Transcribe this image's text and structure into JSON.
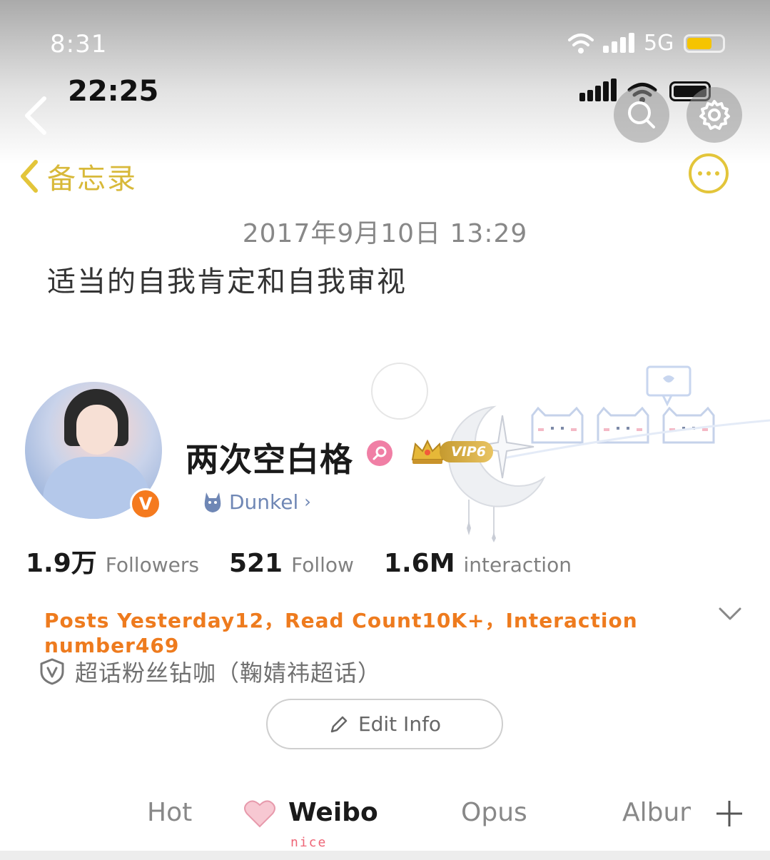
{
  "outer_status": {
    "time": "8:31",
    "network": "5G",
    "battery_color": "#f5c400"
  },
  "inner_status": {
    "time": "22:25"
  },
  "memo": {
    "back_label": "备忘录",
    "date": "2017年9月10日 13:29",
    "body": "适当的自我肯定和自我审视"
  },
  "profile": {
    "name": "两次空白格",
    "verified_badge": "V",
    "vip_label": "VIP6",
    "pet_label": "Dunkel",
    "pet_chevron": "›",
    "stats": [
      {
        "value": "1.9万",
        "label": "Followers"
      },
      {
        "value": "521",
        "label": "Follow"
      },
      {
        "value": "1.6M",
        "label": "interaction"
      }
    ],
    "summary": "Posts Yesterday12，Read Count10K+，Interaction number469",
    "fan_label": "超话粉丝钻咖（鞠婧祎超话）",
    "edit_label": "Edit Info"
  },
  "tabs": {
    "items": [
      "Hot",
      "Weibo",
      "Opus",
      "Album"
    ],
    "active": "Weibo",
    "active_note": "nice"
  },
  "colors": {
    "accent_orange": "#ee7b1e",
    "memo_gold": "#d8b93a",
    "pet_blue": "#6f87b5"
  },
  "icons": [
    "back-chevron-icon",
    "search-icon",
    "gear-icon",
    "more-dots-icon",
    "gender-female-icon",
    "crown-icon",
    "cat-icon",
    "chevron-down-icon",
    "shield-v-icon",
    "pencil-icon",
    "heart-icon",
    "plus-icon"
  ]
}
